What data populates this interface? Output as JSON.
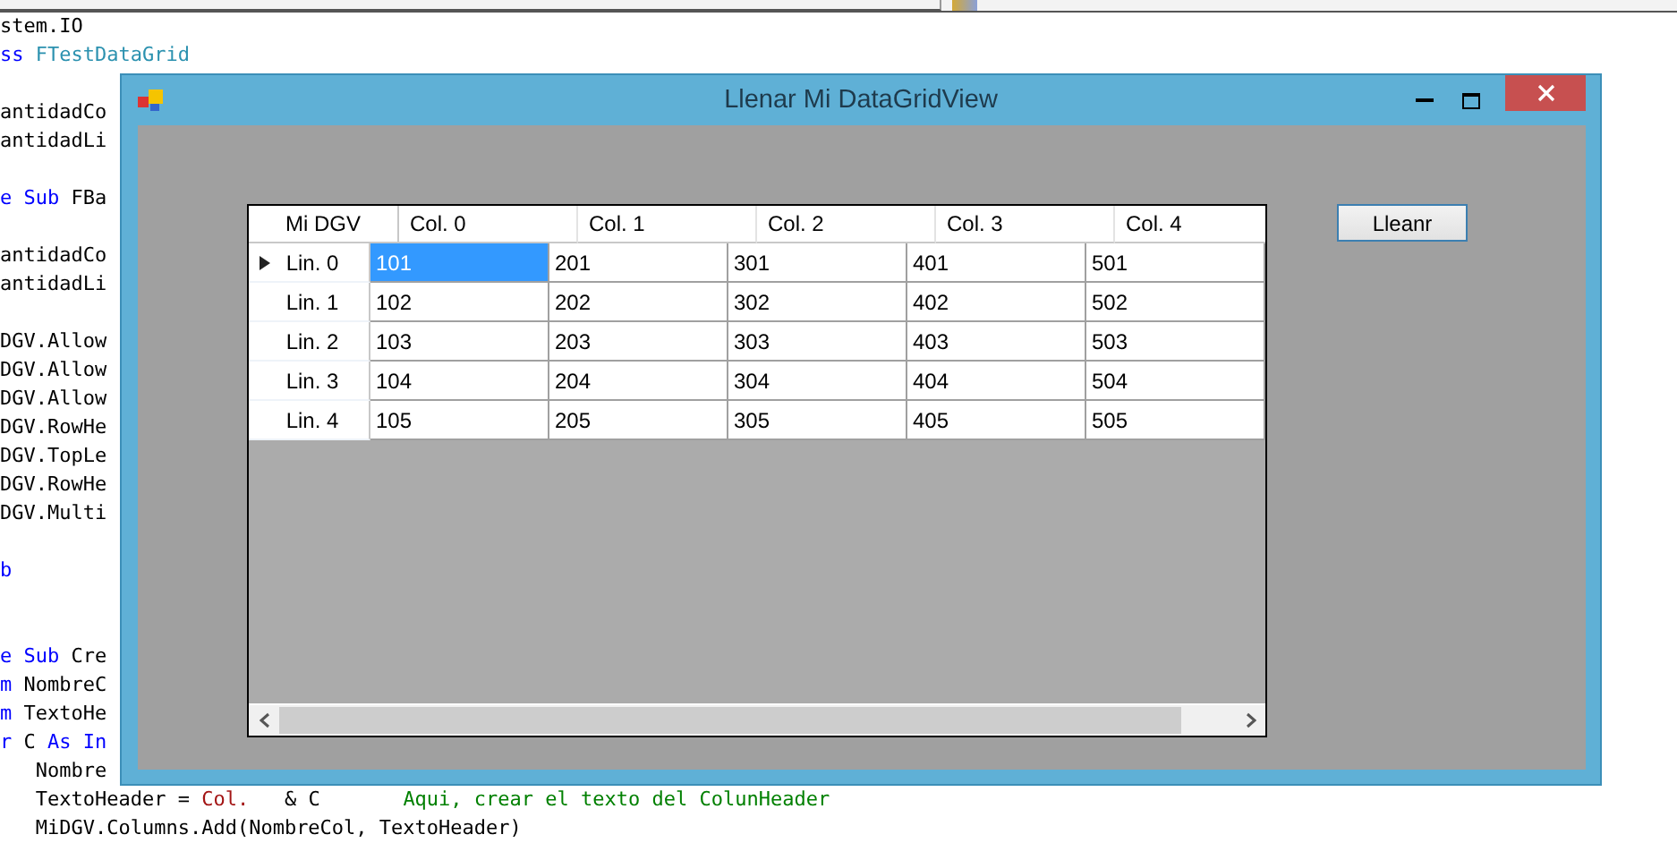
{
  "editor": {
    "lines": [
      {
        "kind": "code",
        "segments": [
          {
            "kind": "plain",
            "text": "stem.IO"
          }
        ]
      },
      {
        "kind": "code",
        "segments": [
          {
            "kind": "keyword",
            "text": "ss "
          },
          {
            "kind": "type",
            "text": "FTestDataGrid"
          }
        ]
      },
      {
        "kind": "blank"
      },
      {
        "kind": "code",
        "segments": [
          {
            "kind": "plain",
            "text": "antidadCo"
          }
        ]
      },
      {
        "kind": "code",
        "segments": [
          {
            "kind": "plain",
            "text": "antidadLi"
          }
        ]
      },
      {
        "kind": "blank"
      },
      {
        "kind": "code",
        "segments": [
          {
            "kind": "keyword",
            "text": "e Sub "
          },
          {
            "kind": "plain",
            "text": "FBa"
          }
        ]
      },
      {
        "kind": "blank"
      },
      {
        "kind": "code",
        "segments": [
          {
            "kind": "plain",
            "text": "antidadCo"
          }
        ]
      },
      {
        "kind": "code",
        "segments": [
          {
            "kind": "plain",
            "text": "antidadLi"
          }
        ]
      },
      {
        "kind": "blank"
      },
      {
        "kind": "code",
        "segments": [
          {
            "kind": "plain",
            "text": "DGV.Allow"
          }
        ]
      },
      {
        "kind": "code",
        "segments": [
          {
            "kind": "plain",
            "text": "DGV.Allow"
          }
        ]
      },
      {
        "kind": "code",
        "segments": [
          {
            "kind": "plain",
            "text": "DGV.Allow"
          }
        ]
      },
      {
        "kind": "code",
        "segments": [
          {
            "kind": "plain",
            "text": "DGV.RowHe"
          }
        ]
      },
      {
        "kind": "code",
        "segments": [
          {
            "kind": "plain",
            "text": "DGV.TopLe"
          }
        ]
      },
      {
        "kind": "code",
        "segments": [
          {
            "kind": "plain",
            "text": "DGV.RowHe"
          }
        ]
      },
      {
        "kind": "code",
        "segments": [
          {
            "kind": "plain",
            "text": "DGV.Multi"
          }
        ]
      },
      {
        "kind": "blank"
      },
      {
        "kind": "code",
        "segments": [
          {
            "kind": "keyword",
            "text": "b"
          }
        ]
      },
      {
        "kind": "blank"
      },
      {
        "kind": "blank"
      },
      {
        "kind": "code",
        "segments": [
          {
            "kind": "keyword",
            "text": "e Sub "
          },
          {
            "kind": "plain",
            "text": "Cre"
          }
        ]
      },
      {
        "kind": "code",
        "segments": [
          {
            "kind": "keyword",
            "text": "m "
          },
          {
            "kind": "plain",
            "text": "NombreC"
          }
        ]
      },
      {
        "kind": "code",
        "segments": [
          {
            "kind": "keyword",
            "text": "m "
          },
          {
            "kind": "plain",
            "text": "TextoHe"
          }
        ]
      },
      {
        "kind": "code",
        "segments": [
          {
            "kind": "keyword",
            "text": "r "
          },
          {
            "kind": "plain",
            "text": "C "
          },
          {
            "kind": "keyword",
            "text": "As In"
          }
        ]
      },
      {
        "kind": "code",
        "segments": [
          {
            "kind": "plain",
            "text": "   Nombre"
          }
        ]
      },
      {
        "kind": "code",
        "segments": [
          {
            "kind": "plain",
            "text": "   TextoHeader = "
          },
          {
            "kind": "string",
            "text": "Col."
          },
          {
            "kind": "plain",
            "text": "   & C       "
          },
          {
            "kind": "comment",
            "text": "Aqui, crear el texto del ColunHeader"
          }
        ]
      },
      {
        "kind": "code",
        "segments": [
          {
            "kind": "plain",
            "text": "   MiDGV.Columns.Add(NombreCol, TextoHeader)"
          }
        ]
      }
    ]
  },
  "dialog": {
    "title": "Llenar Mi DataGridView",
    "grid": {
      "corner_header": "Mi DGV",
      "columns": [
        "Col. 0",
        "Col. 1",
        "Col. 2",
        "Col. 3",
        "Col. 4"
      ],
      "rows": [
        {
          "header": "Lin. 0",
          "current": true,
          "cells": [
            {
              "text": "101",
              "selected": true
            },
            {
              "text": "201",
              "selected": false
            },
            {
              "text": "301",
              "selected": false
            },
            {
              "text": "401",
              "selected": false
            },
            {
              "text": "501",
              "selected": false
            }
          ]
        },
        {
          "header": "Lin. 1",
          "current": false,
          "cells": [
            {
              "text": "102",
              "selected": false
            },
            {
              "text": "202",
              "selected": false
            },
            {
              "text": "302",
              "selected": false
            },
            {
              "text": "402",
              "selected": false
            },
            {
              "text": "502",
              "selected": false
            }
          ]
        },
        {
          "header": "Lin. 2",
          "current": false,
          "cells": [
            {
              "text": "103",
              "selected": false
            },
            {
              "text": "203",
              "selected": false
            },
            {
              "text": "303",
              "selected": false
            },
            {
              "text": "403",
              "selected": false
            },
            {
              "text": "503",
              "selected": false
            }
          ]
        },
        {
          "header": "Lin. 3",
          "current": false,
          "cells": [
            {
              "text": "104",
              "selected": false
            },
            {
              "text": "204",
              "selected": false
            },
            {
              "text": "304",
              "selected": false
            },
            {
              "text": "404",
              "selected": false
            },
            {
              "text": "504",
              "selected": false
            }
          ]
        },
        {
          "header": "Lin. 4",
          "current": false,
          "cells": [
            {
              "text": "105",
              "selected": false
            },
            {
              "text": "205",
              "selected": false
            },
            {
              "text": "305",
              "selected": false
            },
            {
              "text": "405",
              "selected": false
            },
            {
              "text": "505",
              "selected": false
            }
          ]
        }
      ]
    },
    "button": "Lleanr"
  }
}
